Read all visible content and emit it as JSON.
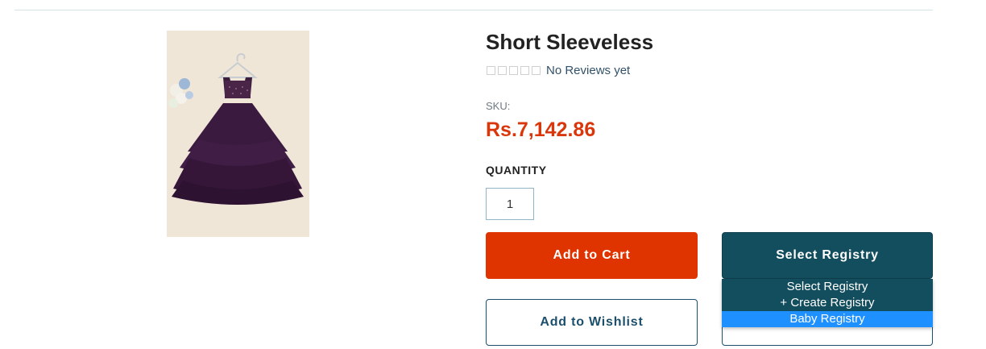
{
  "product": {
    "title": "Short Sleeveless",
    "reviews_text": "No Reviews yet",
    "rating_stars": 0,
    "rating_max": 5,
    "sku_label": "SKU:",
    "price": "Rs.7,142.86",
    "image_icon": "dress-photo"
  },
  "quantity": {
    "label": "QUANTITY",
    "value": "1"
  },
  "buttons": {
    "add_to_cart": "Add to Cart",
    "select_registry": "Select Registry",
    "add_to_wishlist": "Add to Wishlist"
  },
  "registry_dropdown": {
    "options": [
      "Select Registry",
      "+ Create Registry",
      "Baby Registry"
    ],
    "highlighted": "Baby Registry"
  },
  "colors": {
    "price": "#d9360b",
    "cart_button": "#e03400",
    "registry_button": "#134e5e",
    "wishlist_border": "#1c4f6b",
    "dropdown_highlight": "#1e90ff"
  }
}
